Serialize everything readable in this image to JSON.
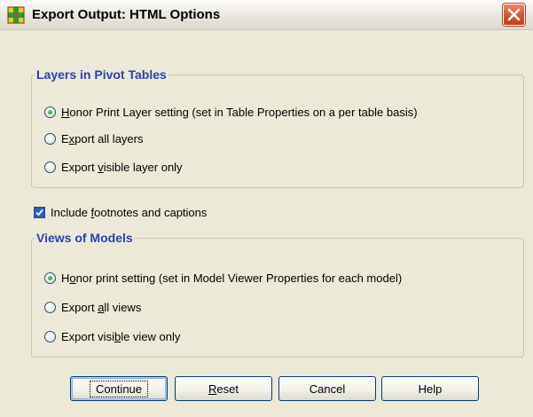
{
  "window": {
    "title": "Export Output: HTML Options",
    "title_icon": "spss-dialog-icon",
    "close_icon": "close-icon"
  },
  "layers_group": {
    "title": "Layers in Pivot Tables",
    "options": [
      {
        "pre": "",
        "ul": "H",
        "post": "onor Print Layer setting (set in Table Properties on a per table basis)",
        "checked": true
      },
      {
        "pre": "E",
        "ul": "x",
        "post": "port all layers",
        "checked": false
      },
      {
        "pre": "Export ",
        "ul": "v",
        "post": "isible layer only",
        "checked": false
      }
    ]
  },
  "footnotes_checkbox": {
    "pre": "Include ",
    "ul": "f",
    "post": "ootnotes and captions",
    "checked": true
  },
  "views_group": {
    "title": "Views of Models",
    "options": [
      {
        "pre": "H",
        "ul": "o",
        "post": "nor print setting (set in Model Viewer Properties for each model)",
        "checked": true
      },
      {
        "pre": "Export ",
        "ul": "a",
        "post": "ll views",
        "checked": false
      },
      {
        "pre": "Export visi",
        "ul": "b",
        "post": "le view only",
        "checked": false
      }
    ]
  },
  "buttons": {
    "continue": "Continue",
    "reset_ul": "R",
    "reset_post": "eset",
    "cancel": "Cancel",
    "help": "Help"
  },
  "colors": {
    "group_title": "#2a3fb6",
    "dialog_bg": "#ece9d8",
    "close_button": "#d2522b"
  }
}
